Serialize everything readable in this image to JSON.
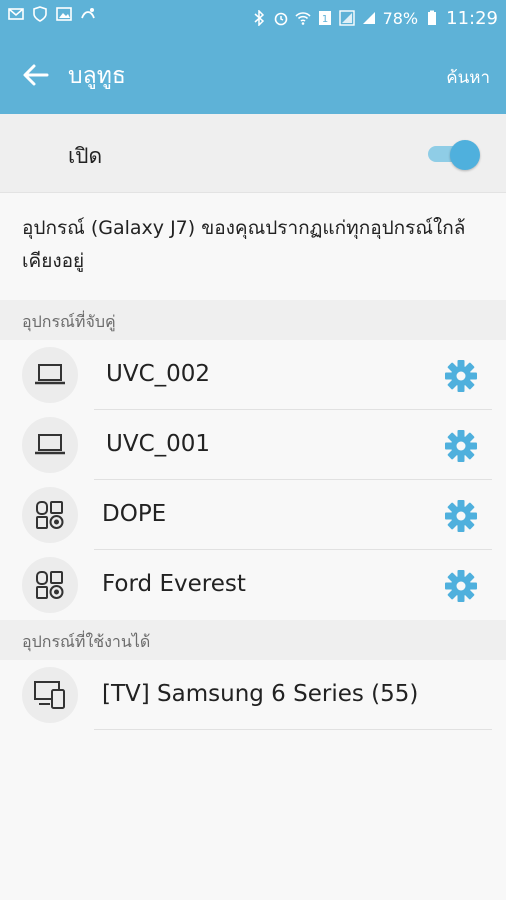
{
  "status_bar": {
    "battery": "78%",
    "time": "11:29"
  },
  "app_bar": {
    "title": "บลูทูธ",
    "search_label": "ค้นหา"
  },
  "toggle": {
    "label": "เปิด",
    "state": "on"
  },
  "description": "อุปกรณ์ (Galaxy J7) ของคุณปรากฏแก่ทุกอุปกรณ์ใกล้เคียงอยู่",
  "paired_section": {
    "header": "อุปกรณ์ที่จับคู่",
    "devices": [
      {
        "name": " UVC_002",
        "icon": "laptop-icon"
      },
      {
        "name": " UVC_001",
        "icon": "laptop-icon"
      },
      {
        "name": "DOPE",
        "icon": "audio-device-icon"
      },
      {
        "name": "Ford Everest",
        "icon": "audio-device-icon"
      }
    ]
  },
  "available_section": {
    "header": "อุปกรณ์ที่ใช้งานได้",
    "devices": [
      {
        "name": "[TV] Samsung 6 Series (55)",
        "icon": "multi-device-icon"
      }
    ]
  },
  "colors": {
    "accent": "#5eb2d7",
    "gear": "#4fb0dd",
    "switch": "#4fb0dd"
  }
}
